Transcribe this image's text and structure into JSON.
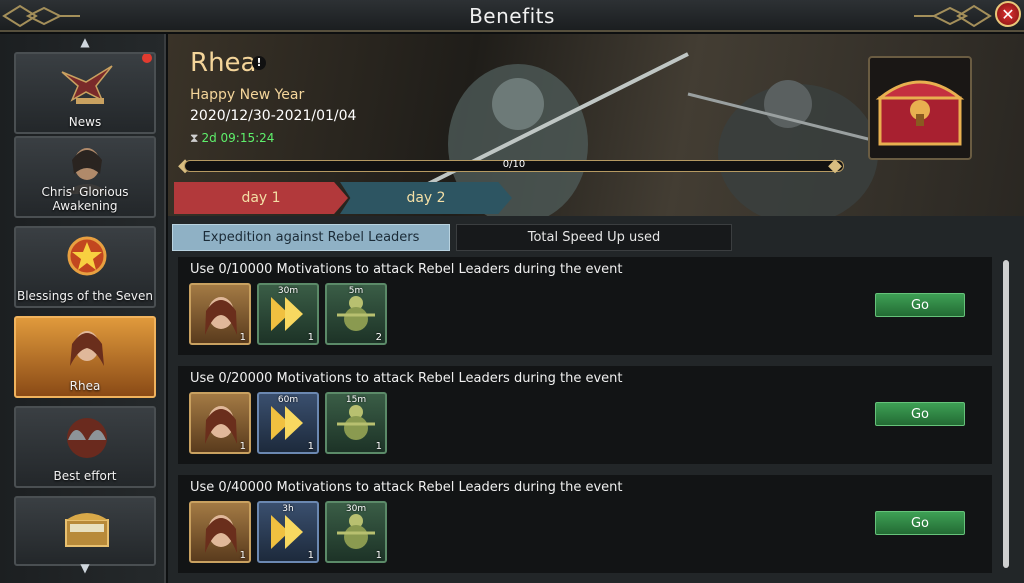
{
  "header": {
    "title": "Benefits",
    "close_icon": "close-icon"
  },
  "sidebar": {
    "items": [
      {
        "label": "News",
        "icon": "eagle-icon",
        "badge": true
      },
      {
        "label": "Chris' Glorious Awakening",
        "icon": "portrait-icon"
      },
      {
        "label": "Blessings of the Seven",
        "icon": "star-emblem-icon"
      },
      {
        "label": "Rhea",
        "icon": "portrait-icon",
        "active": true
      },
      {
        "label": "Best effort",
        "icon": "helmets-icon"
      },
      {
        "label": "",
        "icon": "treasure-chest-icon"
      }
    ]
  },
  "event": {
    "name": "Rhea",
    "info_mark": "!",
    "subtitle": "Happy New Year",
    "dates": "2020/12/30-2021/01/04",
    "timer": "2d 09:15:24",
    "progress_text": "0/10",
    "progress_fraction": 0,
    "chest_icon": "treasure-chest-icon"
  },
  "day_tabs": [
    {
      "label": "day 1",
      "active": true
    },
    {
      "label": "day 2",
      "active": false
    }
  ],
  "sub_tabs": [
    {
      "label": "Expedition against Rebel Leaders",
      "active": true
    },
    {
      "label": "Total Speed Up used",
      "active": false
    }
  ],
  "tasks": [
    {
      "description": "Use 0/10000 Motivations to attack Rebel Leaders during the event",
      "rewards": [
        {
          "icon": "hero-portrait-icon",
          "qty": "1"
        },
        {
          "icon": "speedup-arrow-icon",
          "duration": "30m",
          "qty": "1"
        },
        {
          "icon": "training-dummy-icon",
          "duration": "5m",
          "qty": "2"
        }
      ],
      "button": "Go"
    },
    {
      "description": "Use 0/20000 Motivations to attack Rebel Leaders during the event",
      "rewards": [
        {
          "icon": "hero-portrait-icon",
          "qty": "1"
        },
        {
          "icon": "speedup-arrow-icon",
          "duration": "60m",
          "qty": "1"
        },
        {
          "icon": "training-dummy-icon",
          "duration": "15m",
          "qty": "1"
        }
      ],
      "button": "Go"
    },
    {
      "description": "Use 0/40000 Motivations to attack Rebel Leaders during the event",
      "rewards": [
        {
          "icon": "hero-portrait-icon",
          "qty": "1"
        },
        {
          "icon": "speedup-arrow-icon",
          "duration": "3h",
          "qty": "1"
        },
        {
          "icon": "training-dummy-icon",
          "duration": "30m",
          "qty": "1"
        }
      ],
      "button": "Go"
    }
  ],
  "colors": {
    "accent_gold": "#f4d59a",
    "timer_green": "#5ef06b",
    "go_button": "#3ea055",
    "day1_tab": "#b2393b",
    "day2_tab": "#2d5562",
    "active_sidebar": "#e09a3c"
  }
}
